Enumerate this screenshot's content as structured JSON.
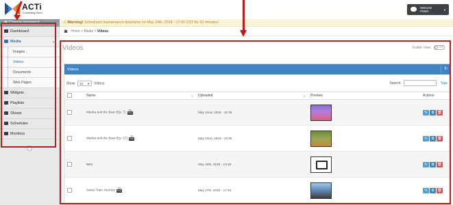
{
  "brand": {
    "logo_text": "ACTi",
    "logo_tagline": "Connecting Vision"
  },
  "change_password": "Change password",
  "sidebar": {
    "items": [
      {
        "label": "Dashboard"
      },
      {
        "label": "Media"
      },
      {
        "label": "Images"
      },
      {
        "label": "Videos"
      },
      {
        "label": "Documents"
      },
      {
        "label": "Web Pages"
      },
      {
        "label": "Widgets"
      },
      {
        "label": "Playlists"
      },
      {
        "label": "Shows"
      },
      {
        "label": "Schedules"
      },
      {
        "label": "Monitors"
      }
    ]
  },
  "welcome": {
    "line1": "Welcome",
    "line2": "PSMO"
  },
  "warning": {
    "strong": "Warning!",
    "text": "Scheduled maintenance downtime on May 24th, 2018 - 17:00 CST for 10 minutes!"
  },
  "breadcrumb": {
    "home": "Home",
    "media": "Media",
    "current": "Videos"
  },
  "page": {
    "title": "Videos",
    "folder_view_label": "Folder View:",
    "toggle": "OFF"
  },
  "panel": {
    "title": "Videos"
  },
  "tools": {
    "show_label": "Show",
    "show_value": "10",
    "show_suffix": "Videos",
    "search_label": "Search:",
    "tags": "Tags"
  },
  "table": {
    "headers": {
      "name": "Name",
      "uploaded": "Uploaded",
      "preview": "Preview",
      "actions": "Actions"
    },
    "rows": [
      {
        "name": "Masha and the Bear (Ep. 7)",
        "uploaded": "May 22nd, 2018 - 10:36",
        "youtube": true
      },
      {
        "name": "Masha and the Bear (Ep. 57)",
        "uploaded": "May 22nd, 2018 - 10:36",
        "youtube": true
      },
      {
        "name": "BBS",
        "uploaded": "May 18th, 2018 - 10:26",
        "youtube": false
      },
      {
        "name": "Swiss Train Journey",
        "uploaded": "May 17th, 2018 - 17:34",
        "youtube": true
      }
    ]
  },
  "youtube_badge": {
    "top": "You",
    "bottom": "Tube"
  },
  "colors": {
    "accent": "#3d83c6",
    "annotation": "#c11a1a",
    "warning_bg": "#fbf3d5",
    "delete": "#e05050"
  }
}
